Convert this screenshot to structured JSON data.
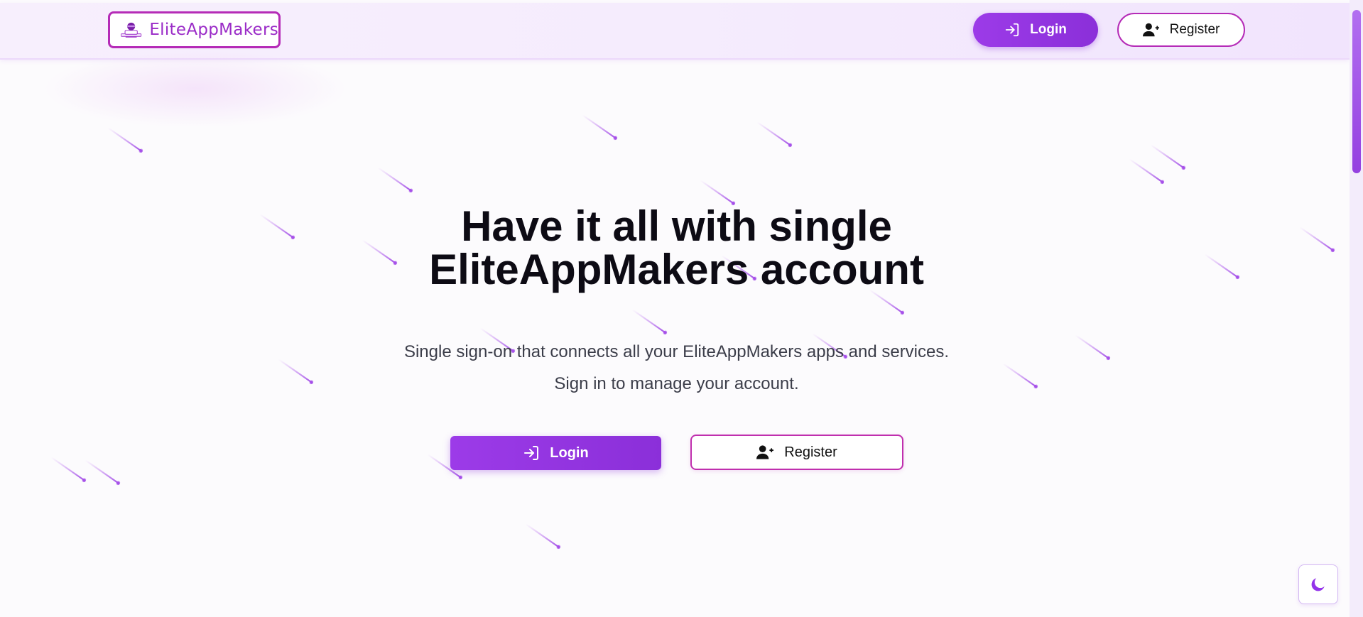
{
  "header": {
    "logo_text": "EliteAppMakers",
    "login_label": "Login",
    "register_label": "Register"
  },
  "hero": {
    "title_line1": "Have it all with single",
    "title_line2": "EliteAppMakers account",
    "subtitle_line1": "Single sign-on that connects all your EliteAppMakers apps and services.",
    "subtitle_line2": "Sign in to manage your account.",
    "login_label": "Login",
    "register_label": "Register"
  },
  "colors": {
    "accent": "#9333ea",
    "brand_border": "#b52bb7",
    "text_dark": "#0d0b14"
  },
  "icons": {
    "login": "login-arrow-icon",
    "register": "user-plus-icon",
    "theme": "moon-icon",
    "logo": "developer-avatar-icon"
  }
}
